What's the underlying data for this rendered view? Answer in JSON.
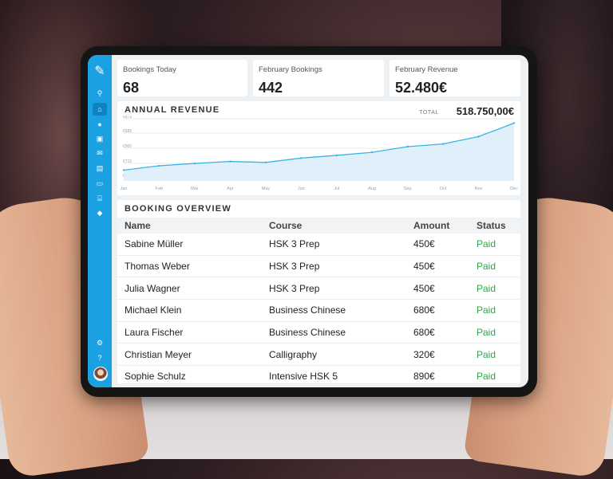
{
  "stats": [
    {
      "label": "Bookings Today",
      "value": "68"
    },
    {
      "label": "February Bookings",
      "value": "442"
    },
    {
      "label": "February Revenue",
      "value": "52.480€"
    }
  ],
  "revenue": {
    "title": "ANNUAL REVENUE",
    "total_label": "TOTAL",
    "total_value": "518.750,00€"
  },
  "chart_data": {
    "type": "area",
    "title": "ANNUAL REVENUE",
    "categories": [
      "Jan",
      "Feb",
      "Mar",
      "Apr",
      "May",
      "Jun",
      "Jul",
      "Aug",
      "Sep",
      "Oct",
      "Nov",
      "Dec"
    ],
    "y_tick_labels": [
      "€650",
      "€715",
      "€900",
      "€585",
      "€572"
    ],
    "values": [
      32,
      45,
      52,
      58,
      55,
      68,
      76,
      85,
      102,
      110,
      132,
      172
    ],
    "ylim": [
      0,
      185
    ],
    "grid": true,
    "color": "#3bb3e6"
  },
  "bookings": {
    "title": "BOOKING OVERVIEW",
    "columns": [
      "Name",
      "Course",
      "Amount",
      "Status"
    ],
    "rows": [
      {
        "name": "Sabine Müller",
        "course": "HSK 3 Prep",
        "amount": "450€",
        "status": "Paid"
      },
      {
        "name": "Thomas Weber",
        "course": "HSK 3 Prep",
        "amount": "450€",
        "status": "Paid"
      },
      {
        "name": "Julia Wagner",
        "course": "HSK 3 Prep",
        "amount": "450€",
        "status": "Paid"
      },
      {
        "name": "Michael Klein",
        "course": "Business Chinese",
        "amount": "680€",
        "status": "Paid"
      },
      {
        "name": "Laura Fischer",
        "course": "Business Chinese",
        "amount": "680€",
        "status": "Paid"
      },
      {
        "name": "Christian Meyer",
        "course": "Calligraphy",
        "amount": "320€",
        "status": "Paid"
      },
      {
        "name": "Sophie Schulz",
        "course": "Intensive HSK 5",
        "amount": "890€",
        "status": "Paid"
      }
    ]
  },
  "sidebar": {
    "icons": [
      "search-icon",
      "home-icon",
      "user-icon",
      "id-card-icon",
      "mail-icon",
      "document-icon",
      "ticket-icon",
      "bank-icon",
      "tag-icon"
    ],
    "bottom_icons": [
      "gear-icon",
      "help-icon"
    ]
  },
  "colors": {
    "accent": "#1ba1e2",
    "paid": "#2aa84a"
  }
}
